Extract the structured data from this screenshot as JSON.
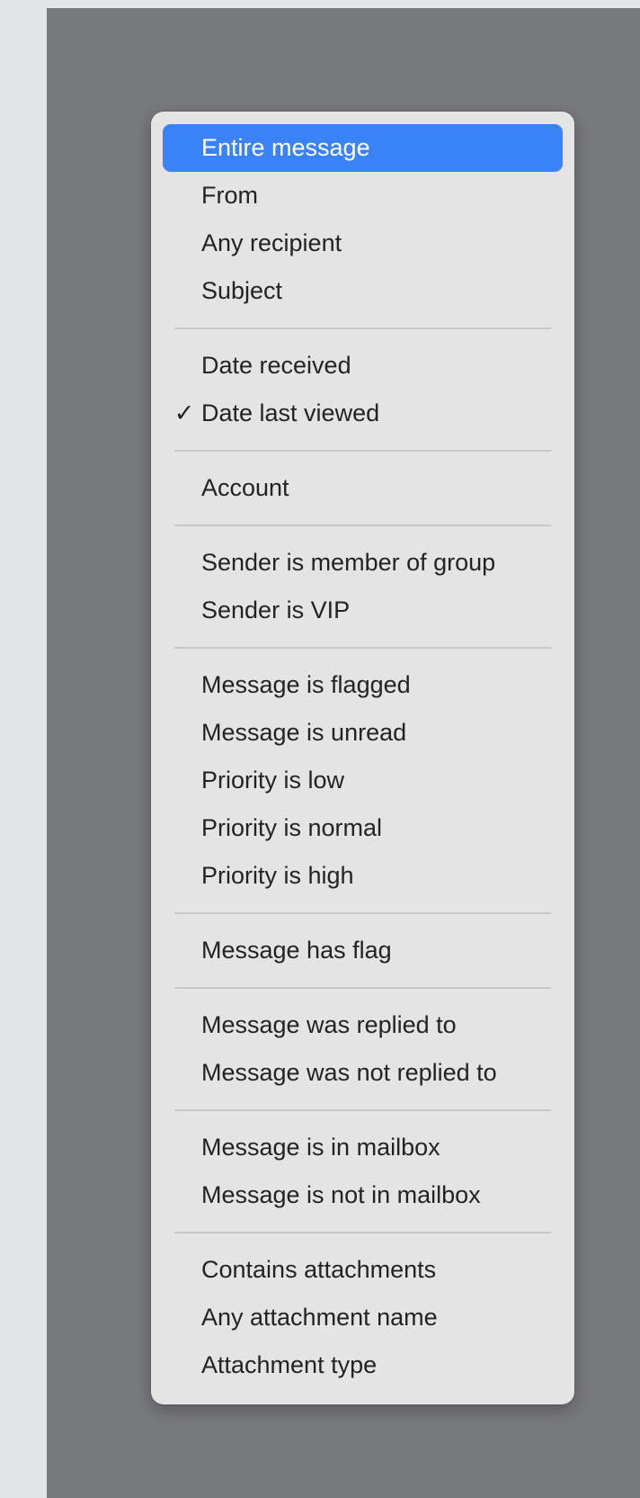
{
  "menu": {
    "check_glyph": "✓",
    "groups": [
      [
        "Entire message",
        "From",
        "Any recipient",
        "Subject"
      ],
      [
        "Date received",
        "Date last viewed"
      ],
      [
        "Account"
      ],
      [
        "Sender is member of group",
        "Sender is VIP"
      ],
      [
        "Message is flagged",
        "Message is unread",
        "Priority is low",
        "Priority is normal",
        "Priority is high"
      ],
      [
        "Message has flag"
      ],
      [
        "Message was replied to",
        "Message was not replied to"
      ],
      [
        "Message is in mailbox",
        "Message is not in mailbox"
      ],
      [
        "Contains attachments",
        "Any attachment name",
        "Attachment type"
      ]
    ],
    "highlighted_item": "Entire message",
    "checked_item": "Date last viewed",
    "highlight_color": "#3a82f7"
  }
}
